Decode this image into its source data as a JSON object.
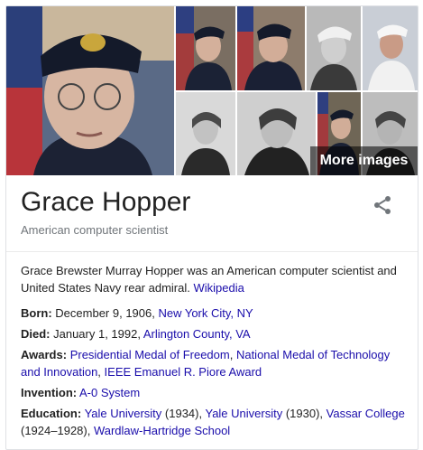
{
  "images": {
    "more_label": "More images"
  },
  "header": {
    "title": "Grace Hopper",
    "subtitle": "American computer scientist"
  },
  "description": {
    "text": "Grace Brewster Murray Hopper was an American computer scientist and United States Navy rear admiral. ",
    "source_link": "Wikipedia"
  },
  "facts": {
    "born": {
      "label": "Born:",
      "text": " December 9, 1906, ",
      "link": "New York City, NY"
    },
    "died": {
      "label": "Died:",
      "text": " January 1, 1992, ",
      "link": "Arlington County, VA"
    },
    "awards": {
      "label": "Awards:",
      "link1": "Presidential Medal of Freedom",
      "sep1": ", ",
      "link2": "National Medal of Technology and Innovation",
      "sep2": ", ",
      "link3": "IEEE Emanuel R. Piore Award"
    },
    "invention": {
      "label": "Invention:",
      "link": "A-0 System"
    },
    "education": {
      "label": "Education:",
      "link1": "Yale University",
      "text1": " (1934), ",
      "link2": "Yale University",
      "text2": " (1930), ",
      "link3": "Vassar College",
      "text3": " (1924–1928), ",
      "link4": "Wardlaw-Hartridge School"
    }
  },
  "colors": {
    "link": "#1a0dab",
    "muted": "#70757a",
    "border": "#dfe1e5"
  },
  "icons": {
    "share": "share-icon"
  }
}
